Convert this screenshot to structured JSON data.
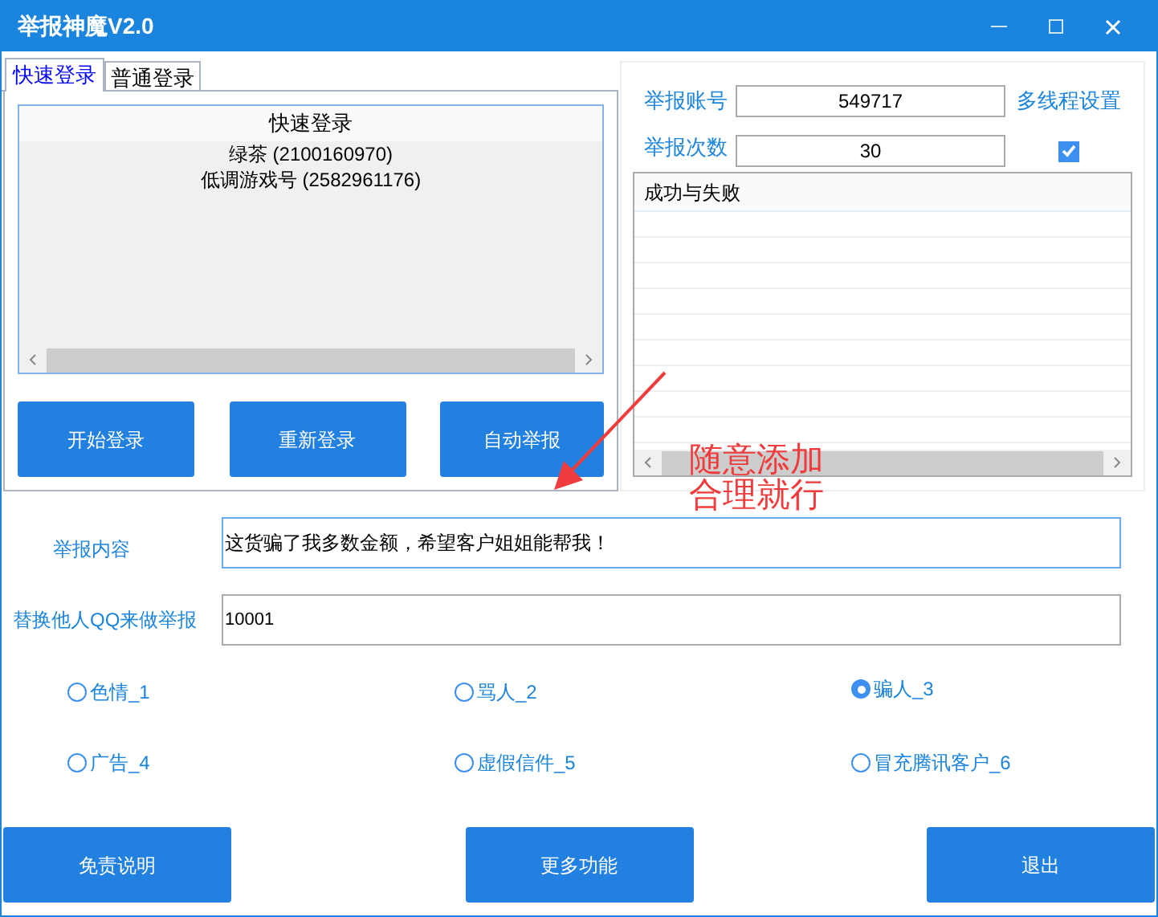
{
  "window": {
    "title": "举报神魔V2.0"
  },
  "login_tabs": [
    {
      "label": "快速登录",
      "selected": true
    },
    {
      "label": "普通登录",
      "selected": false
    }
  ],
  "quick_login_list": {
    "header": "快速登录",
    "items": [
      "绿茶 (2100160970)",
      "低调游戏号 (2582961176)"
    ]
  },
  "login_buttons": [
    "开始登录",
    "重新登录",
    "自动举报"
  ],
  "report_account": {
    "label": "举报账号",
    "value": "549717"
  },
  "multithread_link": "多线程设置",
  "report_count": {
    "label": "举报次数",
    "value": "30"
  },
  "multithread_checkbox": {
    "checked": true
  },
  "result_list": {
    "header": "成功与失败"
  },
  "report_content": {
    "label": "举报内容",
    "value": "这货骗了我多数金额，希望客户姐姐能帮我！"
  },
  "substitute_qq": {
    "label": "替换他人QQ来做举报",
    "value": "10001"
  },
  "categories": [
    {
      "label": "色情_1",
      "selected": false
    },
    {
      "label": "骂人_2",
      "selected": false
    },
    {
      "label": "骗人_3",
      "selected": true
    },
    {
      "label": "广告_4",
      "selected": false
    },
    {
      "label": "虚假信件_5",
      "selected": false
    },
    {
      "label": "冒充腾讯客户_6",
      "selected": false
    }
  ],
  "bottom_buttons": [
    "免责说明",
    "更多功能",
    "退出"
  ],
  "annotation": {
    "lines": [
      "随意添加",
      "合理就行"
    ]
  }
}
